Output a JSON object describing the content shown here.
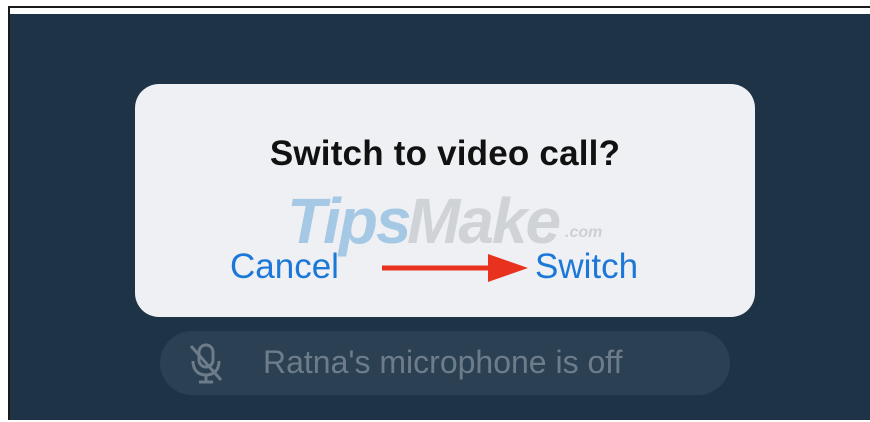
{
  "dialog": {
    "title": "Switch to video call?",
    "cancel_label": "Cancel",
    "switch_label": "Switch"
  },
  "watermark": {
    "tips": "Tips",
    "make": "Make",
    "com": ".com"
  },
  "banner": {
    "text": "Ratna's microphone is off",
    "icon": "microphone-off-icon"
  },
  "colors": {
    "background": "#1f3347",
    "dialog": "#eef0f3",
    "action_blue": "#1c78d8",
    "arrow_red": "#e8321e",
    "banner": "#2b4052",
    "banner_text": "#6d7c8a"
  }
}
